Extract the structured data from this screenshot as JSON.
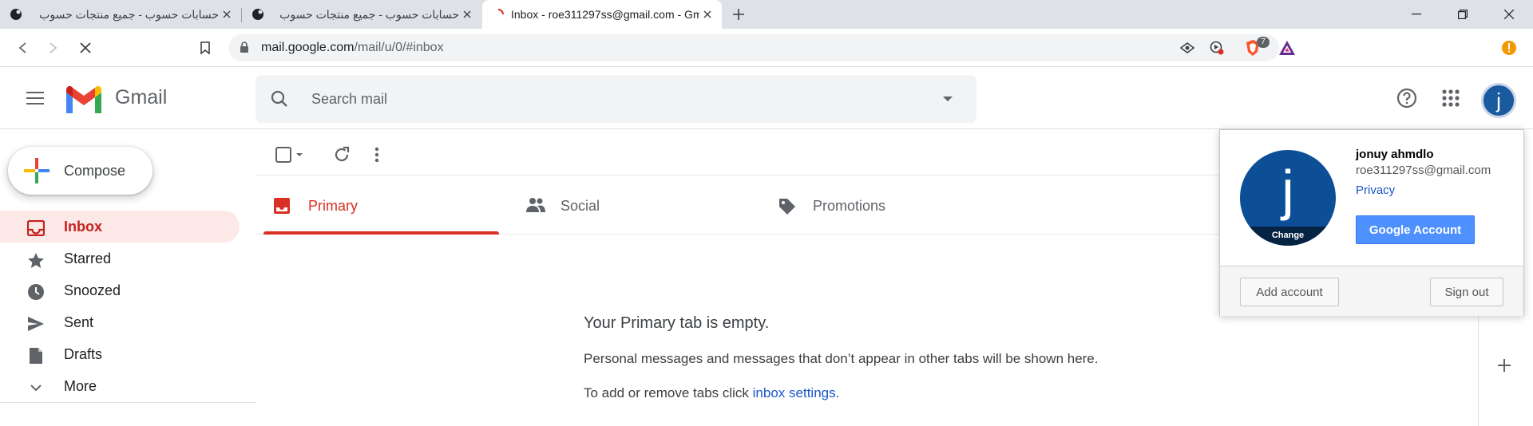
{
  "browser": {
    "tabs": [
      {
        "title": "حسابات حسوب - جميع منتجات حسوب",
        "active": false
      },
      {
        "title": "حسابات حسوب - جميع منتجات حسوب",
        "active": false
      },
      {
        "title": "Inbox - roe311297ss@gmail.com - Gmail",
        "active": true
      }
    ],
    "url_host": "mail.google.com",
    "url_path": "/mail/u/0/#inbox",
    "extension_badge": "7"
  },
  "header": {
    "app_name": "Gmail",
    "search_placeholder": "Search mail",
    "avatar_letter": "j"
  },
  "sidebar": {
    "compose_label": "Compose",
    "items": [
      {
        "label": "Inbox",
        "icon": "inbox-icon",
        "active": true
      },
      {
        "label": "Starred",
        "icon": "star-icon",
        "active": false
      },
      {
        "label": "Snoozed",
        "icon": "clock-icon",
        "active": false
      },
      {
        "label": "Sent",
        "icon": "send-icon",
        "active": false
      },
      {
        "label": "Drafts",
        "icon": "draft-icon",
        "active": false
      },
      {
        "label": "More",
        "icon": "chevron-down-icon",
        "active": false
      }
    ]
  },
  "main": {
    "tabs": [
      {
        "label": "Primary",
        "icon": "inbox-icon",
        "active": true
      },
      {
        "label": "Social",
        "icon": "people-icon",
        "active": false
      },
      {
        "label": "Promotions",
        "icon": "tag-icon",
        "active": false
      }
    ],
    "empty_title": "Your Primary tab is empty.",
    "empty_line1": "Personal messages and messages that don’t appear in other tabs will be shown here.",
    "empty_line2_prefix": "To add or remove tabs click ",
    "empty_line2_link": "inbox settings",
    "empty_line2_suffix": "."
  },
  "account_popup": {
    "avatar_letter": "j",
    "change_label": "Change",
    "name": "jonuy ahmdlo",
    "email": "roe311297ss@gmail.com",
    "privacy_label": "Privacy",
    "google_account_label": "Google Account",
    "add_account_label": "Add account",
    "sign_out_label": "Sign out"
  },
  "colors": {
    "gmail_red": "#d93025",
    "active_nav_bg": "#fce8e6",
    "avatar_blue": "#0d4f96",
    "google_account_button": "#4d90fe"
  }
}
